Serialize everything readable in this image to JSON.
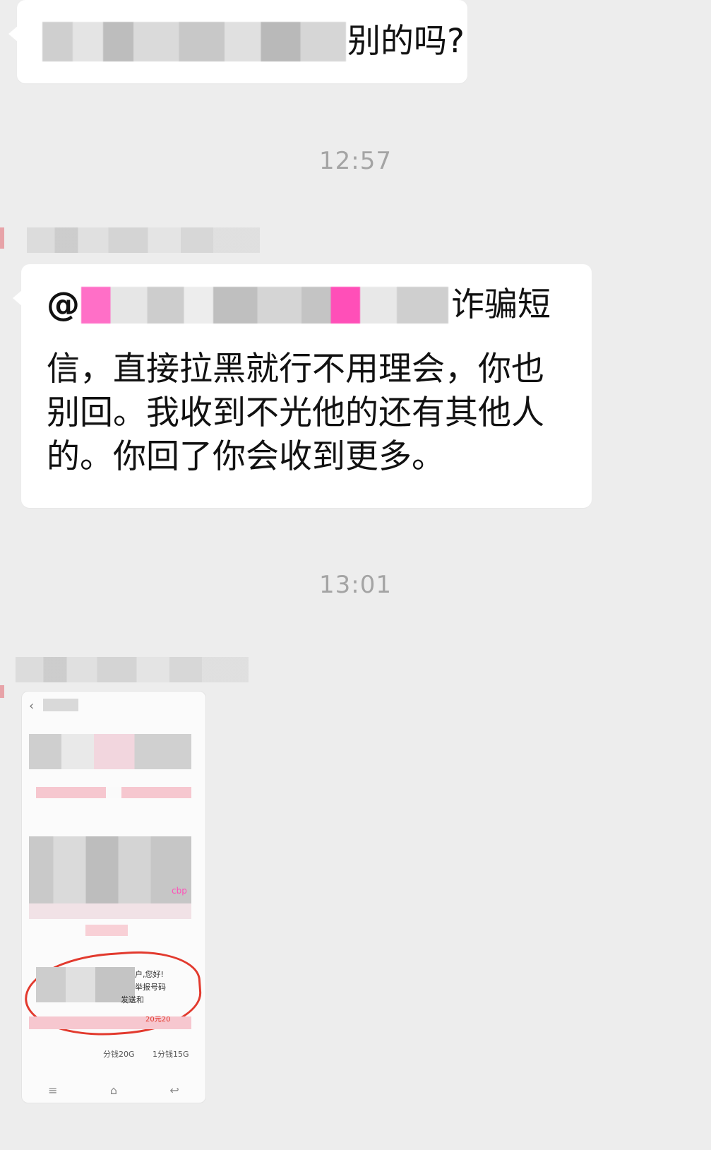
{
  "chat": {
    "message_1": {
      "visible_text": "别的吗?"
    },
    "time_1": "12:57",
    "message_2": {
      "at_sign": "@",
      "line_1_visible": "诈骗短",
      "body": "信，直接拉黑就行不用理会，你也别回。我收到不光他的还有其他人的。你回了你会收到更多。"
    },
    "time_2": "13:01",
    "image_message": {
      "fragments": [
        "户,您好!",
        "举报号码",
        "发送和",
        "cbp",
        "分钱20G",
        "1分钱15G",
        "20元20"
      ],
      "nav_icons": [
        "menu-icon",
        "home-icon",
        "back-icon"
      ]
    }
  },
  "colors": {
    "background": "#ededed",
    "bubble": "#ffffff",
    "timestamp": "#a4a4a4",
    "highlight_pink": "#ff4fb8",
    "annotation_red": "#e23a2e"
  }
}
